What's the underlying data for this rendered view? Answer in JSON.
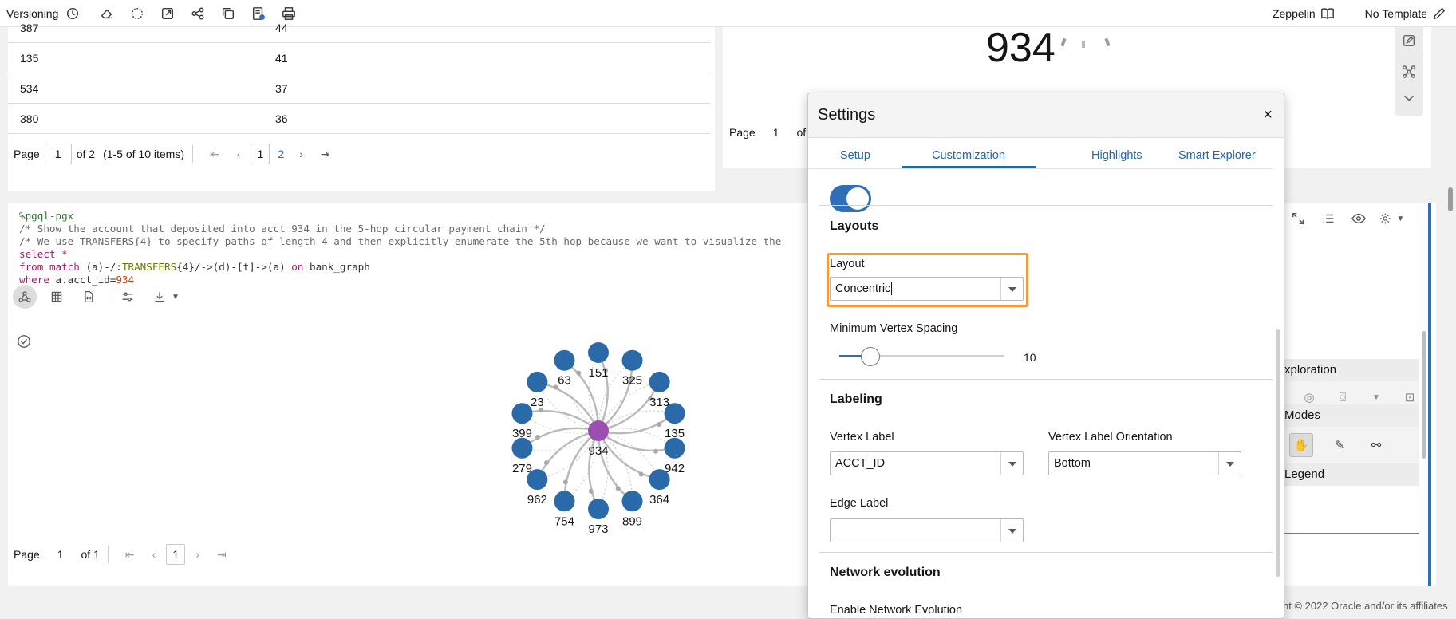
{
  "toolbar": {
    "versioning_label": "Versioning",
    "icons": [
      "history-icon",
      "eraser-icon",
      "magic-icon",
      "export-icon",
      "share-icon",
      "copy-icon",
      "notebook-settings-icon",
      "print-icon"
    ],
    "zeppelin_label": "Zeppelin",
    "template_label": "No Template"
  },
  "result_table": {
    "rows": [
      {
        "col1": "387",
        "col2": "44"
      },
      {
        "col1": "135",
        "col2": "41"
      },
      {
        "col1": "534",
        "col2": "37"
      },
      {
        "col1": "380",
        "col2": "36"
      }
    ],
    "pager": {
      "page_label": "Page",
      "page_value": "1",
      "of_label": "of 2",
      "items_label": "(1-5 of 10 items)",
      "pages": [
        "1",
        "2"
      ],
      "current": "1"
    }
  },
  "top_right": {
    "big_number": "934",
    "pager": {
      "page_label": "Page",
      "page_value": "1",
      "of_label": "of"
    }
  },
  "paragraph": {
    "code": {
      "line1": "%pgql-pgx",
      "line2": "/* Show the account that deposited into acct 934 in the 5-hop circular payment chain */",
      "line3": "/* We use TRANSFERS{4} to specify paths of length 4 and then explicitly enumerate the 5th hop because we want to visualize the",
      "line4_kw": "select",
      "line4_rest": " *",
      "line5_kw1": "from",
      "line5_kw2": "match",
      "line5_a": " (a)-/:",
      "line5_fn": "TRANSFERS",
      "line5_b": "{4}/->(d)-[t]->(a) ",
      "line5_kw3": "on",
      "line5_c": " bank_graph",
      "line6_kw": "where",
      "line6_a": " a.acct_id=",
      "line6_num": "934"
    },
    "graph": {
      "center_label": "934",
      "nodes": [
        "151",
        "325",
        "313",
        "135",
        "942",
        "364",
        "899",
        "973",
        "754",
        "962",
        "279",
        "399",
        "23",
        "63"
      ],
      "node_color": "#2a6aa8",
      "center_color": "#9b4fb0"
    },
    "pager": {
      "page_label": "Page",
      "page_value": "1",
      "of_label": "of 1",
      "current": "1"
    },
    "side_panel": {
      "exploration_label": "xploration",
      "modes_label": "Modes",
      "legend_label": "Legend"
    },
    "footer": "ht © 2022 Oracle and/or its affiliates"
  },
  "settings": {
    "title": "Settings",
    "close": "×",
    "tabs": [
      "Setup",
      "Customization",
      "Highlights",
      "Smart Explorer"
    ],
    "active_tab": "Customization",
    "layouts": {
      "title": "Layouts",
      "layout_label": "Layout",
      "layout_value": "Concentric",
      "min_spacing_label": "Minimum Vertex Spacing",
      "min_spacing_value": "10",
      "min_spacing_fraction": 0.19
    },
    "labeling": {
      "title": "Labeling",
      "vertex_label": "Vertex Label",
      "vertex_value": "ACCT_ID",
      "orientation_label": "Vertex Label Orientation",
      "orientation_value": "Bottom",
      "edge_label": "Edge Label",
      "edge_value": ""
    },
    "network_evolution": {
      "title": "Network evolution",
      "enable_label": "Enable Network Evolution"
    }
  },
  "colors": {
    "accent": "#2f6fb5",
    "highlight": "#f39a3a"
  }
}
